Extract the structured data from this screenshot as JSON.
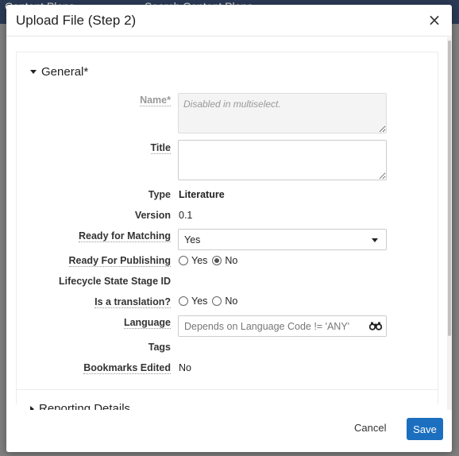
{
  "background": {
    "tab_text": "Content Plans",
    "search_text": "Search Content Plans"
  },
  "modal": {
    "title": "Upload File (Step 2)",
    "close_glyph": "×"
  },
  "sections": {
    "general": {
      "label": "General*",
      "expanded": true
    },
    "reporting": {
      "label": "Reporting Details",
      "expanded": false
    }
  },
  "fields": {
    "name": {
      "label": "Name*",
      "placeholder": "Disabled in multiselect."
    },
    "title": {
      "label": "Title",
      "value": ""
    },
    "type": {
      "label": "Type",
      "value": "Literature"
    },
    "version": {
      "label": "Version",
      "value": "0.1"
    },
    "ready_for_matching": {
      "label": "Ready for Matching",
      "selected": "Yes"
    },
    "ready_for_publishing": {
      "label": "Ready For Publishing",
      "options": [
        "Yes",
        "No"
      ],
      "selected": "No"
    },
    "lifecycle_state_stage_id": {
      "label": "Lifecycle State Stage ID",
      "value": ""
    },
    "is_translation": {
      "label": "Is a translation?",
      "options": [
        "Yes",
        "No"
      ],
      "selected": ""
    },
    "language": {
      "label": "Language",
      "placeholder": "Depends on Language Code != 'ANY'"
    },
    "tags": {
      "label": "Tags",
      "value": ""
    },
    "bookmarks_edited": {
      "label": "Bookmarks Edited",
      "value": "No"
    }
  },
  "footer": {
    "cancel_label": "Cancel",
    "save_label": "Save"
  },
  "colors": {
    "primary": "#1c6fbf",
    "topbar": "#2b3a55",
    "overlay": "#7f7f7f"
  },
  "icons": {
    "close": "close-icon",
    "lookup": "binoculars-icon",
    "section_expanded": "caret-down-icon",
    "section_collapsed": "caret-right-icon",
    "select": "chevron-down-icon"
  }
}
